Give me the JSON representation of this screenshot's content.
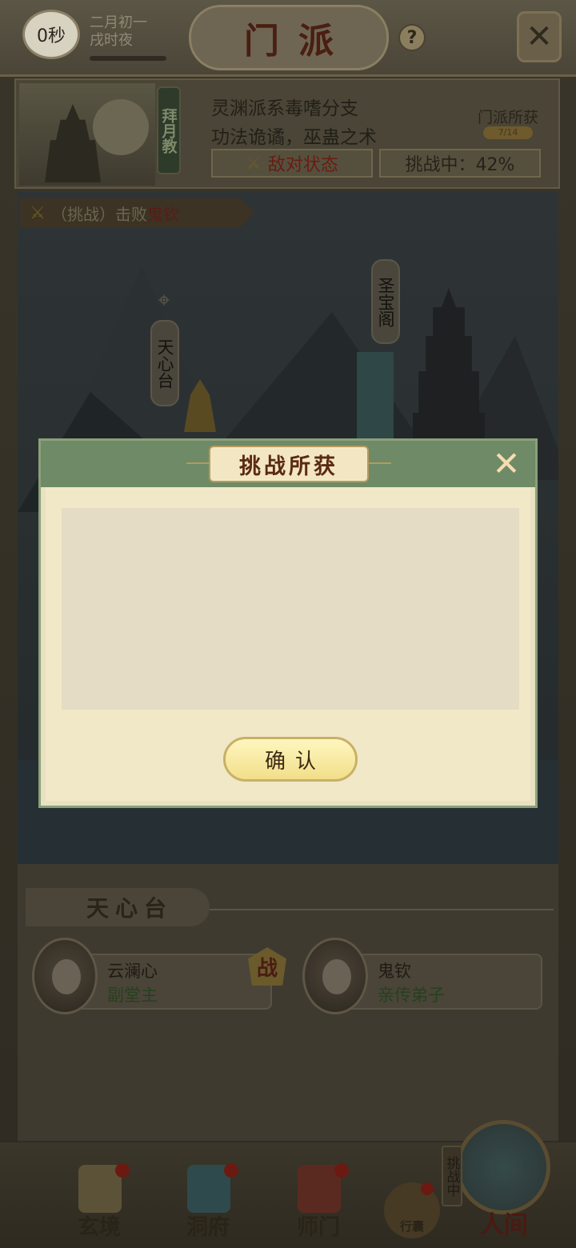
{
  "header": {
    "timer": "0秒",
    "date_line1": "二月初一",
    "date_line2": "戌时夜",
    "title": "门派",
    "help": "?",
    "close_icon": "crossed-swords-close-icon"
  },
  "sect": {
    "tag": "拜月教",
    "desc_line1": "灵渊派系毒嗜分支",
    "desc_line2": "功法诡谲，巫蛊之术",
    "loot_label": "门派所获",
    "loot_count": "7/14",
    "enemy_state": "敌对状态",
    "challenge_progress": "挑战中：42%"
  },
  "map": {
    "task_prefix": "（挑战）击败",
    "task_target": "鬼钦",
    "location_tianxin": "天心台",
    "location_shengbao": "圣宝阁"
  },
  "panel": {
    "title": "天心台",
    "members": [
      {
        "name": "云澜心",
        "role": "副堂主"
      },
      {
        "name": "鬼钦",
        "role": "亲传弟子"
      }
    ],
    "battle_badge": "战"
  },
  "nav": {
    "items": [
      {
        "label": "玄境"
      },
      {
        "label": "洞府"
      },
      {
        "label": "师门"
      },
      {
        "label": "行囊"
      }
    ],
    "main_label": "人间",
    "challenge_tag": "挑战中"
  },
  "modal": {
    "title": "挑战所获",
    "confirm": "确认",
    "close_icon": "crossed-swords-close-icon"
  },
  "colors": {
    "modal_header": "#6f8a67",
    "modal_body": "#f1e8c8",
    "button_yellow": "#f1df8a",
    "enemy_red": "#8b1e10",
    "role_green": "#2e7a2a"
  }
}
